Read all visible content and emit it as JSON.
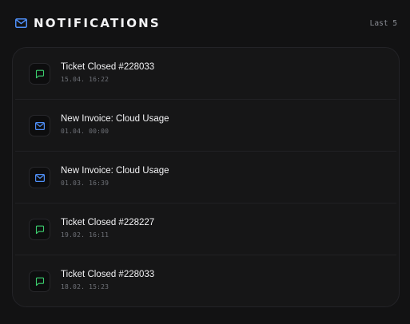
{
  "header": {
    "icon": "mail-icon",
    "title": "NOTIFICATIONS",
    "count_label": "Last 5",
    "accent": "#4f8ff7"
  },
  "notifications": [
    {
      "type": "ticket",
      "icon": "chat-icon",
      "icon_color": "#3ccf6e",
      "title": "Ticket Closed #228033",
      "date": "15.04. 16:22"
    },
    {
      "type": "invoice",
      "icon": "mail-icon",
      "icon_color": "#4f8ff7",
      "title": "New Invoice: Cloud Usage",
      "date": "01.04. 00:00"
    },
    {
      "type": "invoice",
      "icon": "mail-icon",
      "icon_color": "#4f8ff7",
      "title": "New Invoice: Cloud Usage",
      "date": "01.03. 16:39"
    },
    {
      "type": "ticket",
      "icon": "chat-icon",
      "icon_color": "#3ccf6e",
      "title": "Ticket Closed #228227",
      "date": "19.02. 16:11"
    },
    {
      "type": "ticket",
      "icon": "chat-icon",
      "icon_color": "#3ccf6e",
      "title": "Ticket Closed #228033",
      "date": "18.02. 15:23"
    }
  ]
}
